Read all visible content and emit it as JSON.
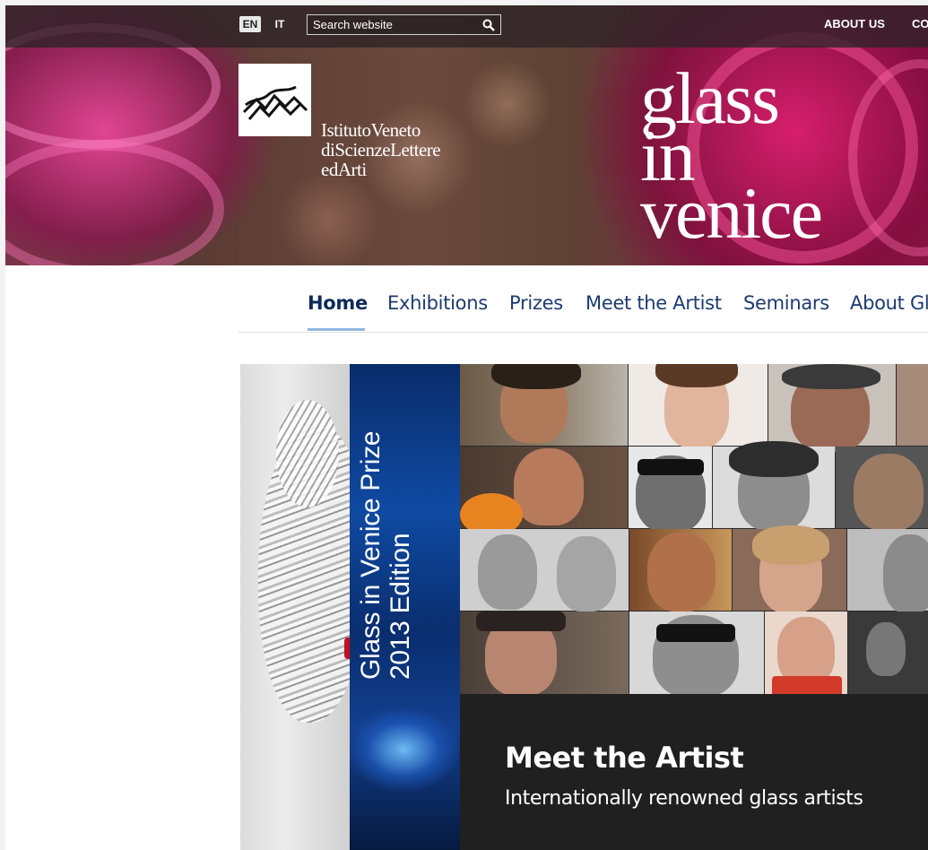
{
  "header": {
    "lang_en": "EN",
    "lang_it": "IT",
    "search_placeholder": "Search website",
    "links": [
      "ABOUT US",
      "CO"
    ],
    "institute_lines": [
      "IstitutoVeneto",
      "diScienzeLettere",
      "edArti"
    ],
    "site_title_lines": [
      "glass",
      "in",
      "venice"
    ]
  },
  "nav": {
    "items": [
      "Home",
      "Exhibitions",
      "Prizes",
      "Meet the Artist",
      "Seminars",
      "About Gl"
    ],
    "active": "Home"
  },
  "hero": {
    "prize_lines": [
      "Glass in Venice Prize",
      "2013 Edition"
    ],
    "caption_title": "Meet the Artist",
    "caption_subtitle": "Internationally renowned glass artists"
  },
  "icons": {
    "search": "search-icon",
    "logo": "institute-logo-icon"
  },
  "colors": {
    "nav_text": "#1c3b6e",
    "nav_active_underline": "#8fb8df",
    "caption_bg": "#202020"
  }
}
